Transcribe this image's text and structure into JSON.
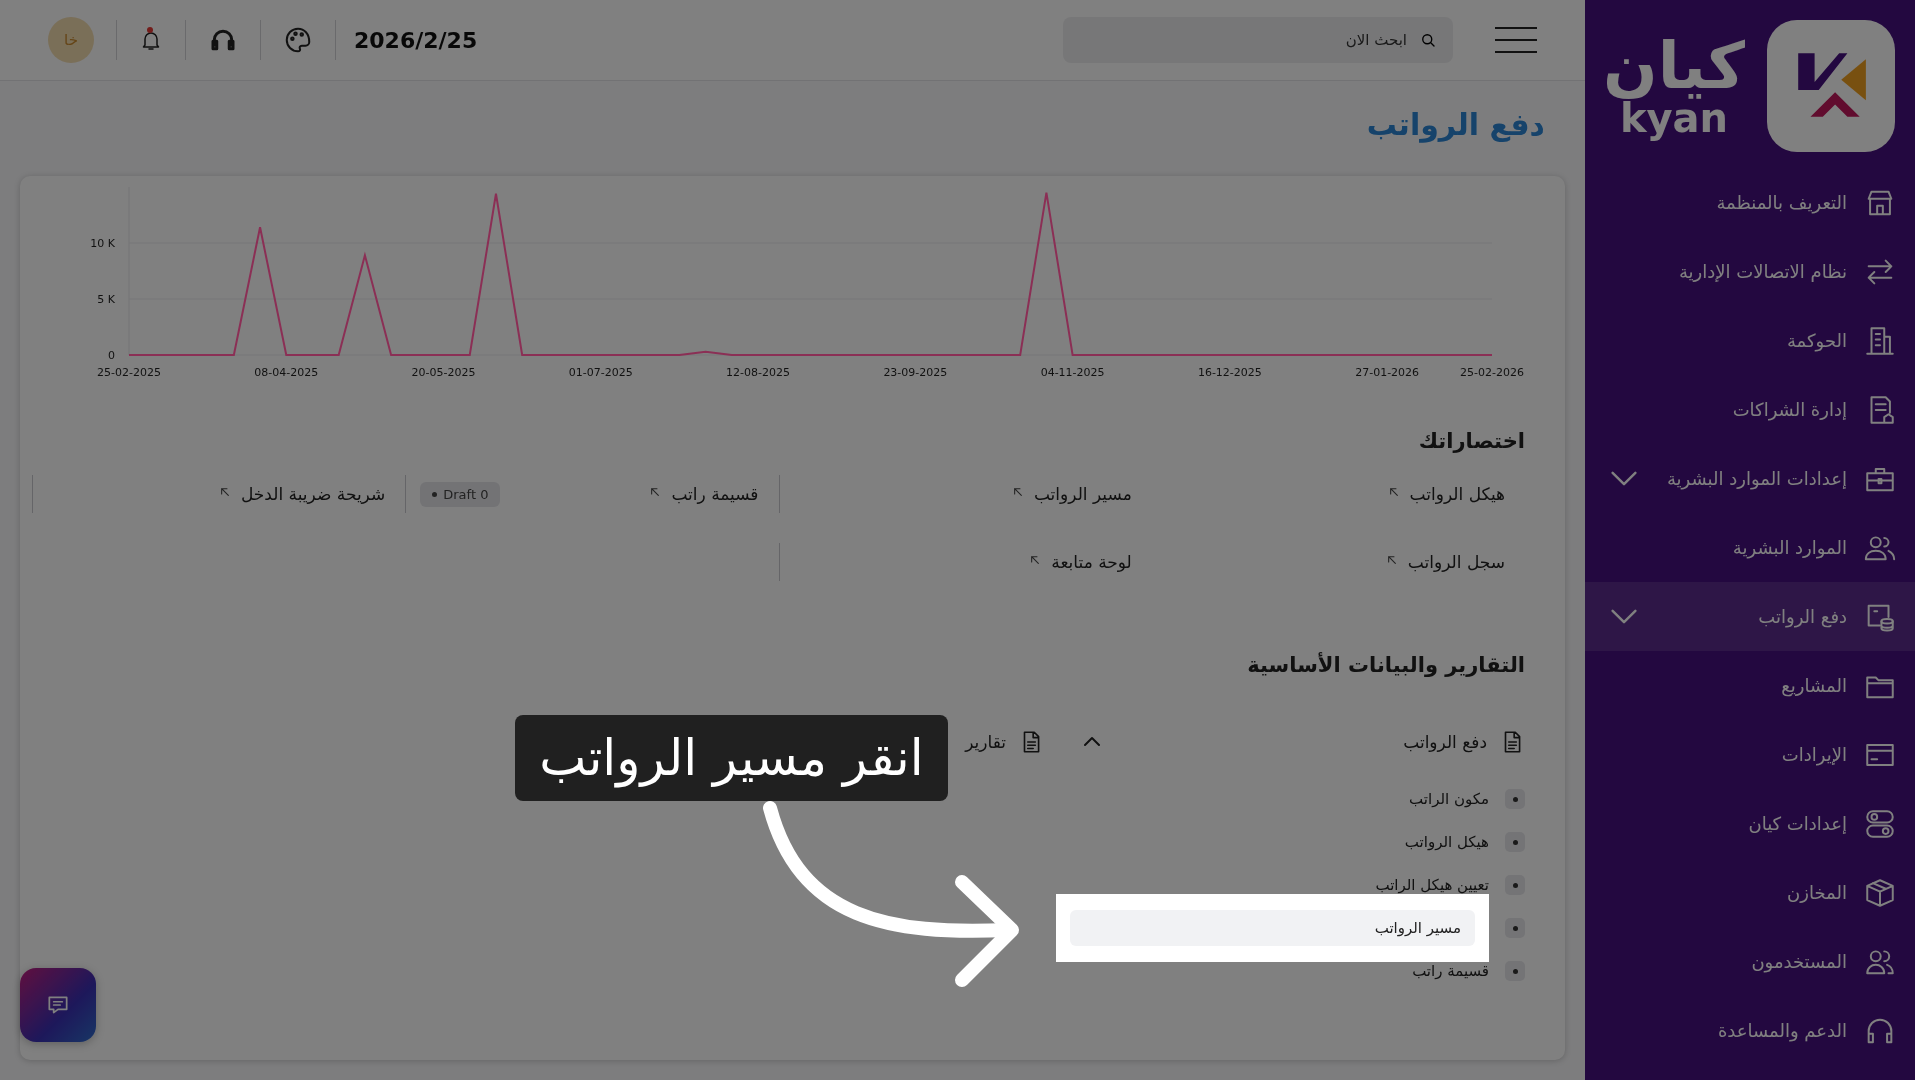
{
  "sidebar": {
    "logo": {
      "name_ar": "كيان",
      "name_en": "kyan"
    },
    "items": [
      {
        "label": "التعريف بالمنظمة",
        "selected": false,
        "expandable": false
      },
      {
        "label": "نظام الاتصالات الإدارية",
        "selected": false,
        "expandable": false
      },
      {
        "label": "الحوكمة",
        "selected": false,
        "expandable": false
      },
      {
        "label": "إدارة الشراكات",
        "selected": false,
        "expandable": false
      },
      {
        "label": "إعدادات الموارد البشرية",
        "selected": false,
        "expandable": true
      },
      {
        "label": "الموارد البشرية",
        "selected": false,
        "expandable": false
      },
      {
        "label": "دفع الرواتب",
        "selected": true,
        "expandable": true
      },
      {
        "label": "المشاريع",
        "selected": false,
        "expandable": false
      },
      {
        "label": "الإيرادات",
        "selected": false,
        "expandable": false
      },
      {
        "label": "إعدادات كيان",
        "selected": false,
        "expandable": false
      },
      {
        "label": "المخازن",
        "selected": false,
        "expandable": false
      },
      {
        "label": "المستخدمون",
        "selected": false,
        "expandable": false
      },
      {
        "label": "الدعم والمساعدة",
        "selected": false,
        "expandable": false
      }
    ]
  },
  "topbar": {
    "search": {
      "placeholder": "ابحث الان"
    },
    "date": "2026/2/25",
    "notifications_unread": true,
    "avatar": "خا"
  },
  "page_title": "دفع الرواتب",
  "chart": {
    "chart_data": {
      "type": "line",
      "categories": [
        "25-02-2025",
        null,
        null,
        null,
        null,
        null,
        "08-04-2025",
        null,
        null,
        null,
        null,
        null,
        "20-05-2025",
        null,
        null,
        null,
        null,
        null,
        "01-07-2025",
        null,
        null,
        null,
        null,
        null,
        "12-08-2025",
        null,
        null,
        null,
        null,
        null,
        "23-09-2025",
        null,
        null,
        null,
        null,
        null,
        "04-11-2025",
        null,
        null,
        null,
        null,
        null,
        "16-12-2025",
        null,
        null,
        null,
        null,
        null,
        "27-01-2026",
        null,
        null,
        null,
        "25-02-2026"
      ],
      "ylim": [
        0,
        15000
      ],
      "series": [
        {
          "color": "#8b2f55",
          "values": [
            0,
            0,
            0,
            0,
            0,
            11400,
            0,
            0,
            0,
            8900,
            0,
            0,
            0,
            0,
            14400,
            0,
            0,
            0,
            0,
            0,
            0,
            0,
            300,
            0,
            0,
            0,
            0,
            0,
            0,
            0,
            0,
            0,
            0,
            0,
            0,
            14500,
            0,
            0,
            0,
            0,
            0,
            0,
            0,
            0,
            0,
            0,
            0,
            0,
            0,
            0,
            0,
            0,
            0
          ]
        }
      ],
      "yticks": [
        {
          "value": 0,
          "label": "0"
        },
        {
          "value": 5000,
          "label": "5 K"
        },
        {
          "value": 10000,
          "label": "10 K"
        }
      ]
    }
  },
  "shortcuts": {
    "title": "اختصاراتك",
    "items": [
      {
        "label": "هيكل الرواتب"
      },
      {
        "label": "مسير الرواتب"
      },
      {
        "label": "قسيمة راتب",
        "badge": "Draft 0"
      },
      {
        "label": "شريحة ضريبة الدخل"
      },
      {
        "label": "سجل الرواتب"
      },
      {
        "label": "لوحة متابعة"
      }
    ]
  },
  "reports": {
    "title": "التقارير والبيانات الأساسية",
    "groups": [
      {
        "title": "دفع الرواتب",
        "expanded": true,
        "items": [
          {
            "label": "مكون الراتب",
            "highlighted": false
          },
          {
            "label": "هيكل الرواتب",
            "highlighted": false
          },
          {
            "label": "تعيين هيكل الراتب",
            "highlighted": false
          },
          {
            "label": "مسير الرواتب",
            "highlighted": true
          },
          {
            "label": "قسيمة راتب",
            "highlighted": false
          }
        ]
      },
      {
        "title": "تقارير",
        "expanded": false
      }
    ]
  },
  "tutorial": {
    "tip": "انقر مسير الرواتب"
  }
}
